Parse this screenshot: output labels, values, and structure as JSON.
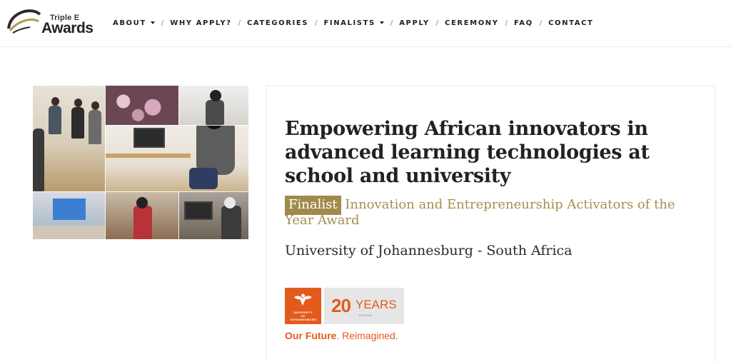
{
  "logo": {
    "line1": "Triple E",
    "line2": "Awards"
  },
  "nav": [
    {
      "label": "ABOUT",
      "dropdown": true
    },
    {
      "label": "WHY APPLY?",
      "dropdown": false
    },
    {
      "label": "CATEGORIES",
      "dropdown": false
    },
    {
      "label": "FINALISTS",
      "dropdown": true
    },
    {
      "label": "APPLY",
      "dropdown": false
    },
    {
      "label": "CEREMONY",
      "dropdown": false
    },
    {
      "label": "FAQ",
      "dropdown": false
    },
    {
      "label": "CONTACT",
      "dropdown": false
    }
  ],
  "nav_separator": "/",
  "article": {
    "title": "Empowering African innovators in advanced learning technologies at school and university",
    "badge": "Finalist",
    "award": "Innovation and Entrepreneurship Activators of the Year Award",
    "institution": "University of Johannesburg - South Africa"
  },
  "uj_logo": {
    "box_line1": "UNIVERSITY",
    "box_line2": "OF",
    "box_line3": "JOHANNESBURG",
    "years_number": "20",
    "years_word": "YEARS",
    "years_range": "2005-2025",
    "tagline_bold": "Our Future",
    "tagline_rest": ". Reimagined."
  },
  "colors": {
    "accent_gold": "#a08a4a",
    "uj_orange": "#e35a1d",
    "text_dark": "#222222"
  }
}
